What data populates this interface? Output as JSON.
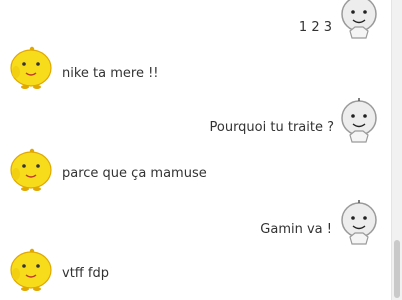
{
  "messages": [
    {
      "side": "right",
      "avatar": "grey-bot-icon",
      "text": "1 2 3"
    },
    {
      "side": "left",
      "avatar": "yellow-chick-icon",
      "text": "nike ta mere !!"
    },
    {
      "side": "right",
      "avatar": "grey-bot-icon",
      "text": "Pourquoi tu traite ?"
    },
    {
      "side": "left",
      "avatar": "yellow-chick-icon",
      "text": "parce que ça mamuse"
    },
    {
      "side": "right",
      "avatar": "grey-bot-icon",
      "text": "Gamin va !"
    },
    {
      "side": "left",
      "avatar": "yellow-chick-icon",
      "text": "vtff fdp"
    }
  ],
  "colors": {
    "chick_body": "#f7dc1c",
    "chick_outline": "#e0a800",
    "bot_head": "#ededed",
    "bot_outline": "#9a9a9a",
    "text": "#333333"
  }
}
